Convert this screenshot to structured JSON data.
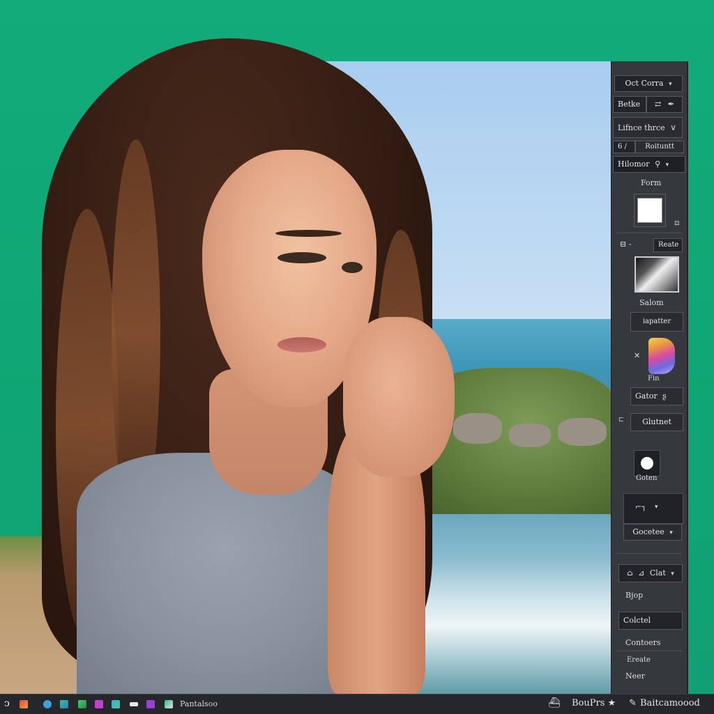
{
  "panel": {
    "btn1": "Oct Corra",
    "btn2": "Betke",
    "btn3": "Lifnce thrce",
    "row4_num": "6 /",
    "row4_label": "Roituntt",
    "btn5": "Hilomor",
    "label_form": "Form",
    "row6_label": "Reate",
    "label_salom": "Salom",
    "btn7": "iapatter",
    "x_mark": "✕",
    "label_fin": "Fin",
    "btn8": "Gator",
    "btn9": "Glutnet",
    "label_goten": "Goten",
    "btn10": "Gocetee",
    "btn11": "Clat",
    "label_bjop": "Bjop",
    "btn12": "Colctel",
    "label_contoers": "Contoers",
    "label_ereate": "Ereate",
    "label_neer": "Neer"
  },
  "taskbar": {
    "app_label": "Pantalsoo",
    "tray_label1": "BouPrs ★",
    "tray_label2": "Baitcamoood"
  },
  "colors": {
    "background": "#13a877",
    "panel": "#35383d",
    "taskbar": "#25272b"
  }
}
